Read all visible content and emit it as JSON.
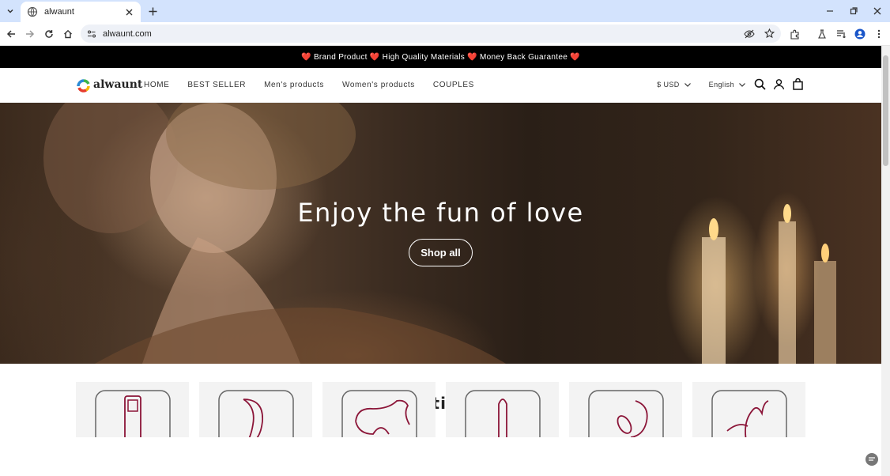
{
  "browser": {
    "tab_title": "alwaunt",
    "url": "alwaunt.com"
  },
  "announcement": {
    "text": "❤️ Brand Product ❤️ High Quality Materials ❤️ Money Back Guarantee ❤️"
  },
  "header": {
    "logo_text": "alwaunt",
    "nav": [
      "HOME",
      "BEST SELLER",
      "Men's products",
      "Women's products",
      "COUPLES"
    ],
    "currency": "$ USD",
    "language": "English"
  },
  "hero": {
    "title": "Enjoy the fun of love",
    "button": "Shop all"
  },
  "collection": {
    "title": "Collection list",
    "icons": [
      "product-icon-1",
      "product-icon-2",
      "product-icon-3",
      "product-icon-4",
      "product-icon-5",
      "product-icon-6"
    ],
    "icon_color": "#8b1538"
  }
}
